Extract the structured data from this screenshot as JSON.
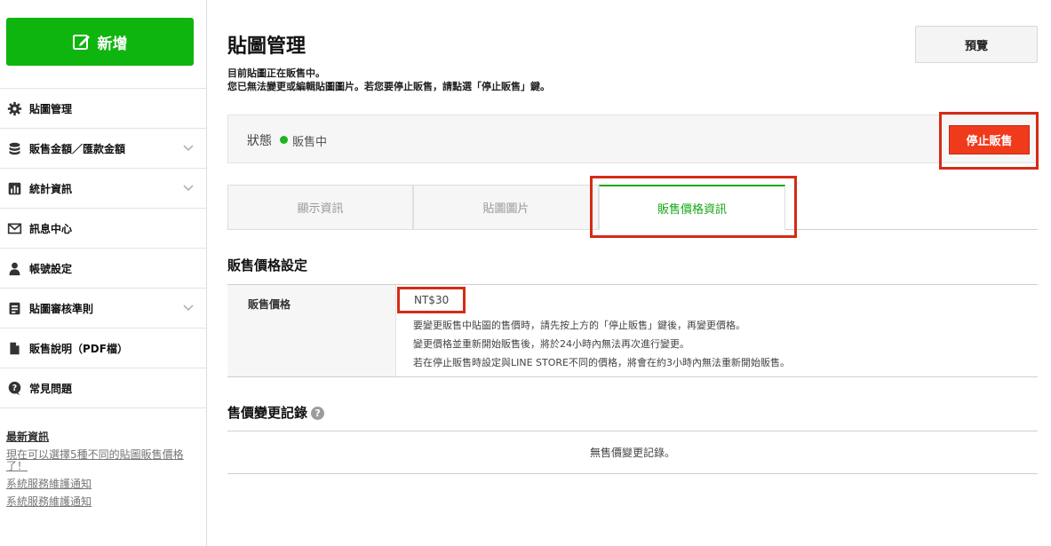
{
  "sidebar": {
    "new_button": "新增",
    "items": [
      {
        "label": "貼圖管理",
        "icon": "gear-icon",
        "expandable": false
      },
      {
        "label": "販售金額／匯款金額",
        "icon": "coins-icon",
        "expandable": true
      },
      {
        "label": "統計資訊",
        "icon": "chart-icon",
        "expandable": true
      },
      {
        "label": "訊息中心",
        "icon": "mail-icon",
        "expandable": false
      },
      {
        "label": "帳號設定",
        "icon": "person-icon",
        "expandable": false
      },
      {
        "label": "貼圖審核準則",
        "icon": "document-icon",
        "expandable": true
      },
      {
        "label": "販售說明（PDF檔）",
        "icon": "file-icon",
        "expandable": false
      },
      {
        "label": "常見問題",
        "icon": "question-icon",
        "expandable": false
      }
    ],
    "news": {
      "heading": "最新資訊",
      "links": [
        "現在可以選擇5種不同的貼圖販售價格了！",
        "系統服務維護通知",
        "系統服務維護通知"
      ]
    }
  },
  "header": {
    "title": "貼圖管理",
    "preview_button": "預覽",
    "notice_line1": "目前貼圖正在販售中。",
    "notice_line2": "您已無法變更或編輯貼圖圖片。若您要停止販售，請點選「停止販售」鍵。"
  },
  "status": {
    "label": "狀態",
    "value": "販售中",
    "stop_button": "停止販售"
  },
  "tabs": [
    {
      "label": "顯示資訊",
      "active": false
    },
    {
      "label": "貼圖圖片",
      "active": false
    },
    {
      "label": "販售價格資訊",
      "active": true
    }
  ],
  "price_section": {
    "title": "販售價格設定",
    "label": "販售價格",
    "value": "NT$30",
    "notes": [
      "要變更販售中貼圖的售價時，請先按上方的「停止販售」鍵後，再變更價格。",
      "變更價格並重新開始販售後，將於24小時內無法再次進行變更。",
      "若在停止販售時設定與LINE STORE不同的價格，將會在約3小時內無法重新開始販售。"
    ]
  },
  "history_section": {
    "title": "售價變更記錄",
    "empty_text": "無售價變更記錄。"
  },
  "colors": {
    "brand_green": "#0fb50f",
    "stop_red": "#f03a1c",
    "highlight_red": "#d42c15"
  }
}
